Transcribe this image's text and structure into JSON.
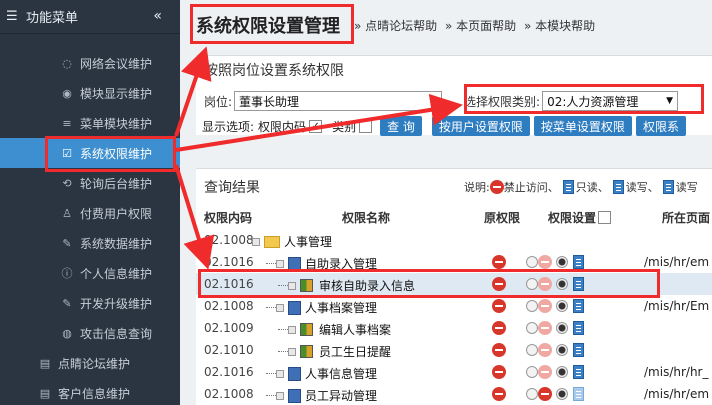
{
  "sidebar": {
    "title": "功能菜单",
    "collapse_glyph": "«",
    "items": [
      {
        "label": "网络会议维护",
        "icon": "chat-icon"
      },
      {
        "label": "模块显示维护",
        "icon": "compass-icon"
      },
      {
        "label": "菜单模块维护",
        "icon": "list-icon"
      },
      {
        "label": "系统权限维护",
        "icon": "checkbox-icon",
        "active": true
      },
      {
        "label": "轮询后台维护",
        "icon": "refresh-icon"
      },
      {
        "label": "付费用户权限",
        "icon": "user-icon"
      },
      {
        "label": "系统数据维护",
        "icon": "wrench-icon"
      },
      {
        "label": "个人信息维护",
        "icon": "info-icon"
      },
      {
        "label": "开发升级维护",
        "icon": "wrench-icon"
      },
      {
        "label": "攻击信息查询",
        "icon": "globe-icon"
      }
    ],
    "top_items": [
      {
        "label": "点睛论坛维护",
        "icon": "doc-icon"
      },
      {
        "label": "客户信息维护",
        "icon": "doc-icon"
      }
    ]
  },
  "header": {
    "title": "系统权限设置管理",
    "crumbs": [
      "» 点晴论坛帮助",
      "» 本页面帮助",
      "» 本模块帮助"
    ]
  },
  "panel": {
    "title": "按照岗位设置系统权限",
    "post_label": "岗位:",
    "post_value": "董事长助理",
    "perm_type_label": "选择权限类别:",
    "perm_type_value": "02:人力资源管理",
    "display_label": "显示选项:",
    "perm_code_label": "权限内码",
    "category_label": "类别",
    "query_button": "查 询",
    "by_user_button": "按用户设置权限",
    "by_menu_button": "按菜单设置权限",
    "perm_button": "权限系"
  },
  "results": {
    "title": "查询结果",
    "legend_prefix": "说明:",
    "legend": [
      "禁止访问、",
      "只读、",
      "读写、",
      "读写"
    ],
    "columns": [
      "权限内码",
      "权限名称",
      "原权限",
      "权限设置",
      "所在页面"
    ],
    "rows": [
      {
        "code": "02.1008",
        "name": "人事管理",
        "path": "",
        "type": "folder"
      },
      {
        "code": "02.1016",
        "name": "自助录入管理",
        "path": "/mis/hr/em",
        "type": "page"
      },
      {
        "code": "02.1016",
        "name": "审核自助录入信息",
        "path": "",
        "type": "grid"
      },
      {
        "code": "02.1008",
        "name": "人事档案管理",
        "path": "/mis/hr/Em",
        "type": "page"
      },
      {
        "code": "02.1009",
        "name": "编辑人事档案",
        "path": "",
        "type": "grid"
      },
      {
        "code": "02.1010",
        "name": "员工生日提醒",
        "path": "",
        "type": "grid"
      },
      {
        "code": "02.1016",
        "name": "人事信息管理",
        "path": "/mis/hr/hr_",
        "type": "page"
      },
      {
        "code": "02.1008",
        "name": "员工异动管理",
        "path": "/mis/hr/em",
        "type": "page"
      }
    ]
  }
}
